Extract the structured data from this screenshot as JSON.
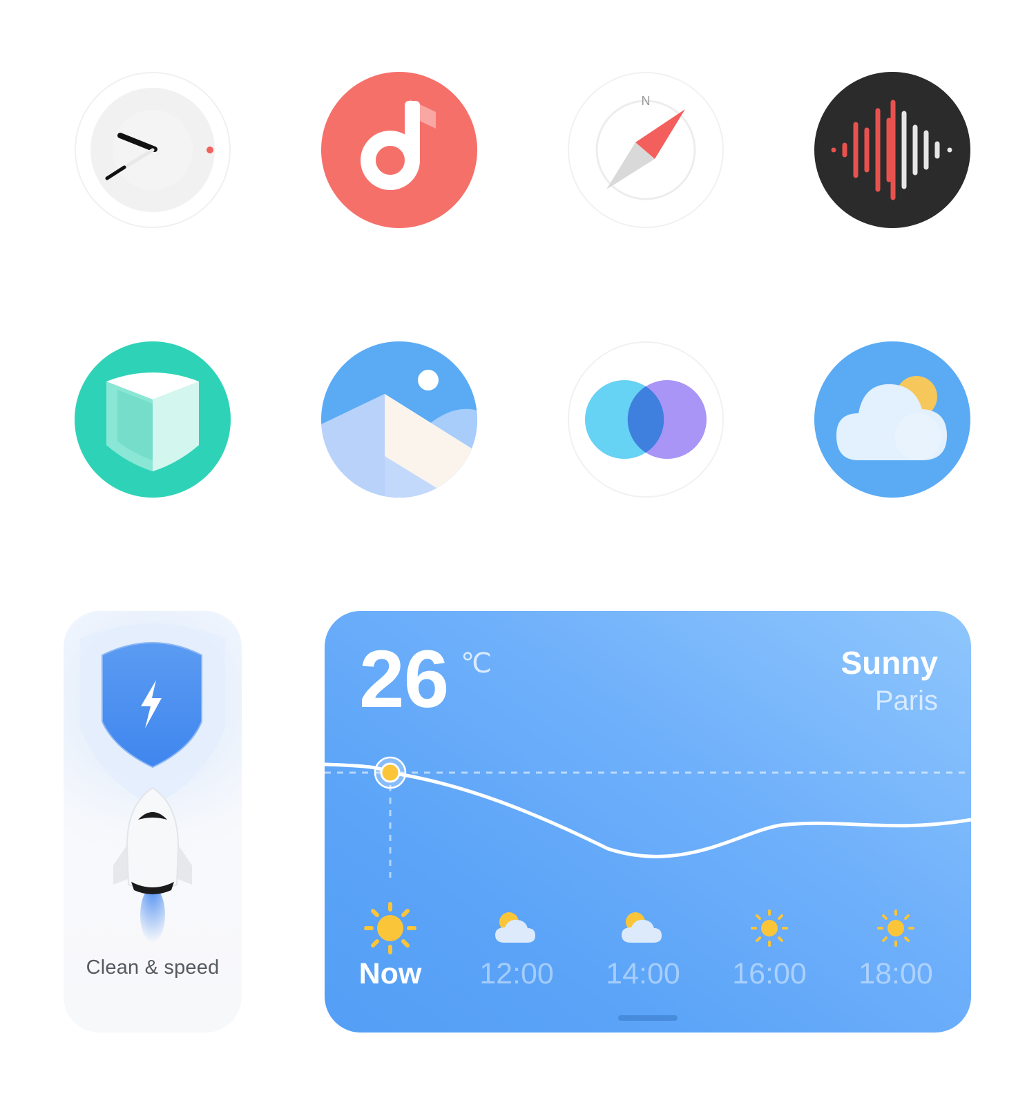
{
  "apps": [
    {
      "name": "Clock",
      "icon": "clock-icon"
    },
    {
      "name": "Music",
      "icon": "music-note-icon",
      "color": "#f6706a"
    },
    {
      "name": "Compass",
      "icon": "compass-icon",
      "north_label": "N"
    },
    {
      "name": "Recorder",
      "icon": "sound-wave-icon",
      "color": "#2b2b2b"
    },
    {
      "name": "Security",
      "icon": "shield-cube-icon",
      "color": "#2ed3b7"
    },
    {
      "name": "Gallery",
      "icon": "mountain-photo-icon",
      "color": "#5aabf4"
    },
    {
      "name": "Themes",
      "icon": "overlapping-circles-icon"
    },
    {
      "name": "Weather",
      "icon": "cloud-sun-icon",
      "color": "#5aabf4"
    }
  ],
  "clean_widget": {
    "label": "Clean & speed",
    "icons": [
      "shield-lightning-icon",
      "rocket-icon"
    ]
  },
  "weather_widget": {
    "temperature": "26",
    "unit": "℃",
    "condition": "Sunny",
    "city": "Paris",
    "hours": [
      {
        "label": "Now",
        "icon": "sun-icon"
      },
      {
        "label": "12:00",
        "icon": "partly-cloudy-icon"
      },
      {
        "label": "14:00",
        "icon": "partly-cloudy-icon"
      },
      {
        "label": "16:00",
        "icon": "sun-icon"
      },
      {
        "label": "18:00",
        "icon": "sun-icon"
      }
    ],
    "colors": {
      "sun": "#fbc53a",
      "background": "#62a8f8"
    }
  }
}
